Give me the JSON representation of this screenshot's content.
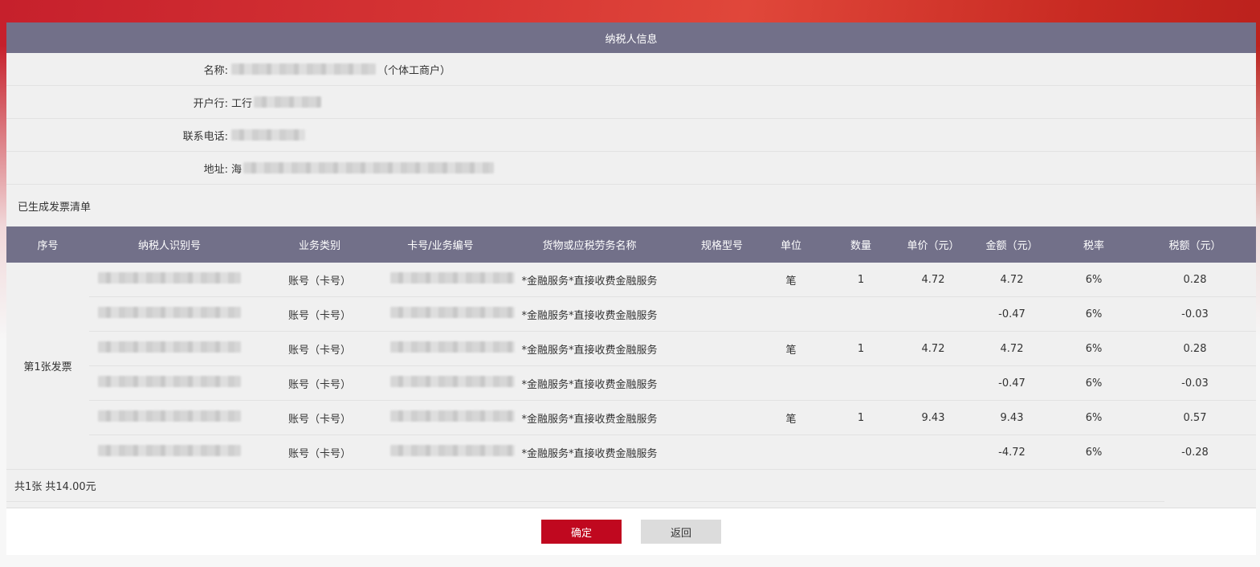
{
  "panel": {
    "title": "纳税人信息"
  },
  "taxpayer": {
    "name_label": "名称:",
    "name_suffix": "（个体工商户）",
    "bank_label": "开户行:",
    "bank_prefix": "工行",
    "phone_label": "联系电话:",
    "address_label": "地址:",
    "address_prefix": "海"
  },
  "invoice_list": {
    "title": "已生成发票清单",
    "columns": [
      "序号",
      "纳税人识别号",
      "业务类别",
      "卡号/业务编号",
      "货物或应税劳务名称",
      "规格型号",
      "单位",
      "数量",
      "单价（元）",
      "金额（元）",
      "税率",
      "税额（元）"
    ],
    "group_label": "第1张发票",
    "rows": [
      {
        "category": "账号（卡号）",
        "item": "*金融服务*直接收费金融服务",
        "spec": "",
        "unit": "笔",
        "qty": "1",
        "price": "4.72",
        "amount": "4.72",
        "rate": "6%",
        "tax": "0.28"
      },
      {
        "category": "账号（卡号）",
        "item": "*金融服务*直接收费金融服务",
        "spec": "",
        "unit": "",
        "qty": "",
        "price": "",
        "amount": "-0.47",
        "rate": "6%",
        "tax": "-0.03"
      },
      {
        "category": "账号（卡号）",
        "item": "*金融服务*直接收费金融服务",
        "spec": "",
        "unit": "笔",
        "qty": "1",
        "price": "4.72",
        "amount": "4.72",
        "rate": "6%",
        "tax": "0.28"
      },
      {
        "category": "账号（卡号）",
        "item": "*金融服务*直接收费金融服务",
        "spec": "",
        "unit": "",
        "qty": "",
        "price": "",
        "amount": "-0.47",
        "rate": "6%",
        "tax": "-0.03"
      },
      {
        "category": "账号（卡号）",
        "item": "*金融服务*直接收费金融服务",
        "spec": "",
        "unit": "笔",
        "qty": "1",
        "price": "9.43",
        "amount": "9.43",
        "rate": "6%",
        "tax": "0.57"
      },
      {
        "category": "账号（卡号）",
        "item": "*金融服务*直接收费金融服务",
        "spec": "",
        "unit": "",
        "qty": "",
        "price": "",
        "amount": "-4.72",
        "rate": "6%",
        "tax": "-0.28"
      }
    ],
    "summary": "共1张 共14.00元"
  },
  "actions": {
    "confirm": "确定",
    "back": "返回"
  },
  "colors": {
    "header_bg": "#727089",
    "primary": "#c0081f",
    "secondary": "#dcdcdc"
  }
}
